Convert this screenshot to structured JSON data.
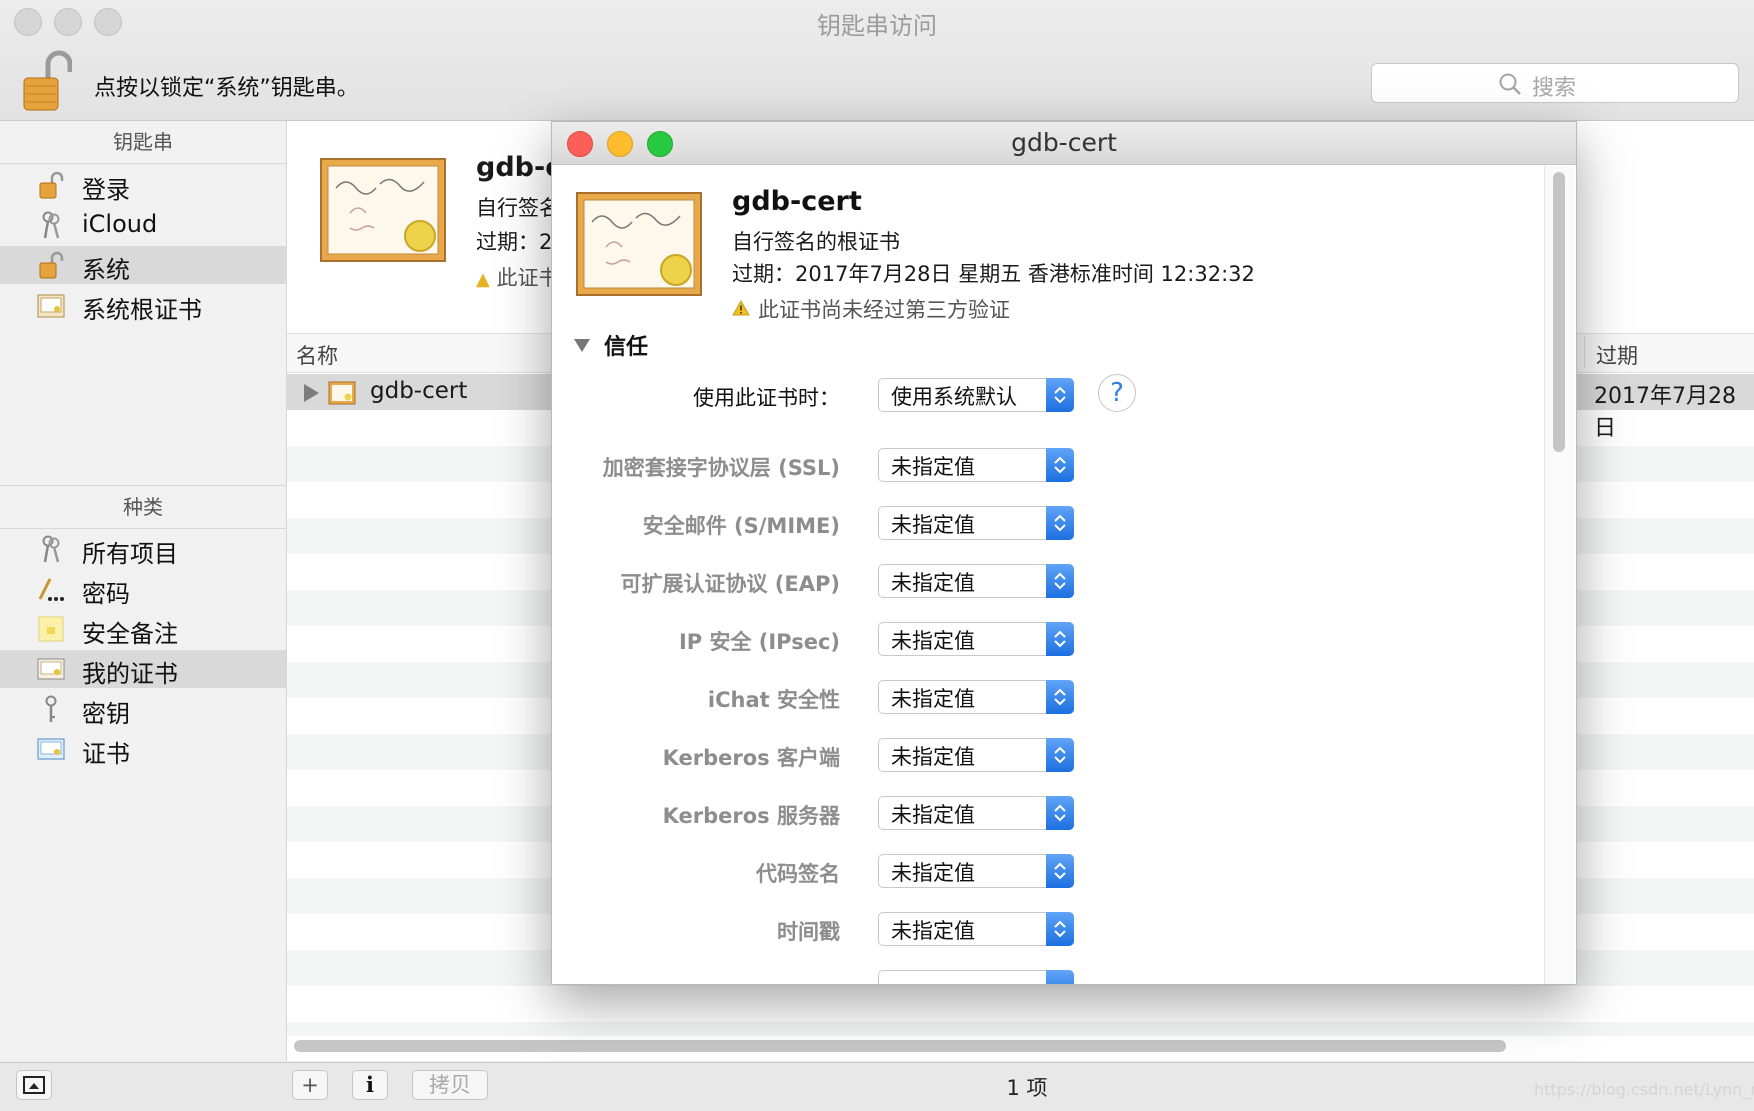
{
  "window": {
    "title": "钥匙串访问",
    "lock_text": "点按以锁定“系统”钥匙串。",
    "search_placeholder": "搜索"
  },
  "sidebar": {
    "keychains_header": "钥匙串",
    "keychains": [
      {
        "label": "登录",
        "icon": "lock-open-icon"
      },
      {
        "label": "iCloud",
        "icon": "keys-icon"
      },
      {
        "label": "系统",
        "icon": "lock-open-icon",
        "selected": true
      },
      {
        "label": "系统根证书",
        "icon": "cabinet-icon"
      }
    ],
    "category_header": "种类",
    "categories": [
      {
        "label": "所有项目",
        "icon": "keys-icon"
      },
      {
        "label": "密码",
        "icon": "password-icon"
      },
      {
        "label": "安全备注",
        "icon": "note-icon"
      },
      {
        "label": "我的证书",
        "icon": "my-cert-icon",
        "selected": true
      },
      {
        "label": "密钥",
        "icon": "key-icon"
      },
      {
        "label": "证书",
        "icon": "certificate-icon"
      }
    ]
  },
  "list": {
    "preview_name": "gdb-c",
    "preview_line1": "自行签名",
    "preview_line2": "过期：2",
    "preview_line3": "此证书",
    "columns": {
      "name": "名称",
      "expires": "过期"
    },
    "rows": [
      {
        "name": "gdb-cert",
        "expires": "2017年7月28日"
      }
    ],
    "count": "1 项"
  },
  "toolbar": {
    "add": "+",
    "info": "i",
    "copy": "拷贝"
  },
  "dialog": {
    "title": "gdb-cert",
    "cert_name": "gdb-cert",
    "cert_type": "自行签名的根证书",
    "expires": "过期：2017年7月28日 星期五 香港标准时间 12:32:32",
    "warning": "此证书尚未经过第三方验证",
    "trust_section": "信任",
    "use_label": "使用此证书时：",
    "use_value": "使用系统默认",
    "help": "?",
    "policies": [
      {
        "label": "加密套接字协议层 (SSL)",
        "value": "未指定值"
      },
      {
        "label": "安全邮件 (S/MIME)",
        "value": "未指定值"
      },
      {
        "label": "可扩展认证协议 (EAP)",
        "value": "未指定值"
      },
      {
        "label": "IP 安全 (IPsec)",
        "value": "未指定值"
      },
      {
        "label": "iChat 安全性",
        "value": "未指定值"
      },
      {
        "label": "Kerberos 客户端",
        "value": "未指定值"
      },
      {
        "label": "Kerberos 服务器",
        "value": "未指定值"
      },
      {
        "label": "代码签名",
        "value": "未指定值"
      },
      {
        "label": "时间戳",
        "value": "未指定值"
      }
    ]
  },
  "watermark": "https://blog.csdn.net/Lynn_mg"
}
